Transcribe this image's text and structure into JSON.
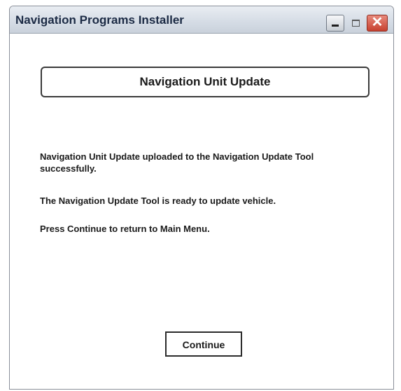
{
  "window": {
    "title": "Navigation Programs Installer",
    "controls": {
      "minimize_icon": "minimize-icon",
      "maximize_icon": "maximize-icon",
      "close_icon": "close-icon",
      "close_glyph": "✕"
    }
  },
  "main": {
    "header": "Navigation Unit Update",
    "messages": [
      "Navigation Unit Update uploaded to the Navigation Update Tool successfully.",
      "The Navigation Update Tool is ready to update vehicle.",
      "Press Continue to return to Main Menu."
    ],
    "continue_label": "Continue"
  },
  "colors": {
    "title_text": "#1b2a44",
    "close_button": "#c7412f"
  }
}
